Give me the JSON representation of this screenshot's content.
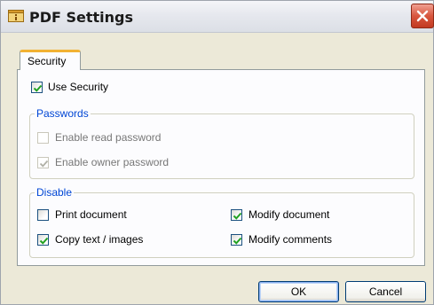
{
  "window": {
    "title": "PDF Settings"
  },
  "tabs": [
    {
      "label": "Security",
      "active": true
    }
  ],
  "security": {
    "use_security": {
      "label": "Use Security",
      "checked": true
    }
  },
  "passwords": {
    "legend": "Passwords",
    "enable_read": {
      "label": "Enable read password",
      "checked": false,
      "enabled": false
    },
    "enable_owner": {
      "label": "Enable owner password",
      "checked": true,
      "enabled": false
    }
  },
  "disable": {
    "legend": "Disable",
    "print_document": {
      "label": "Print document",
      "checked": false
    },
    "copy_text_images": {
      "label": "Copy text / images",
      "checked": true
    },
    "modify_document": {
      "label": "Modify document",
      "checked": true
    },
    "modify_comments": {
      "label": "Modify comments",
      "checked": true
    }
  },
  "buttons": {
    "ok": "OK",
    "cancel": "Cancel"
  },
  "icons": {
    "app": "settings-icon",
    "close": "close-icon",
    "check": "check-icon"
  },
  "colors": {
    "accent_tab": "#f2b233",
    "group_legend": "#0046d5",
    "close": "#d8563e",
    "check": "#21a121"
  }
}
